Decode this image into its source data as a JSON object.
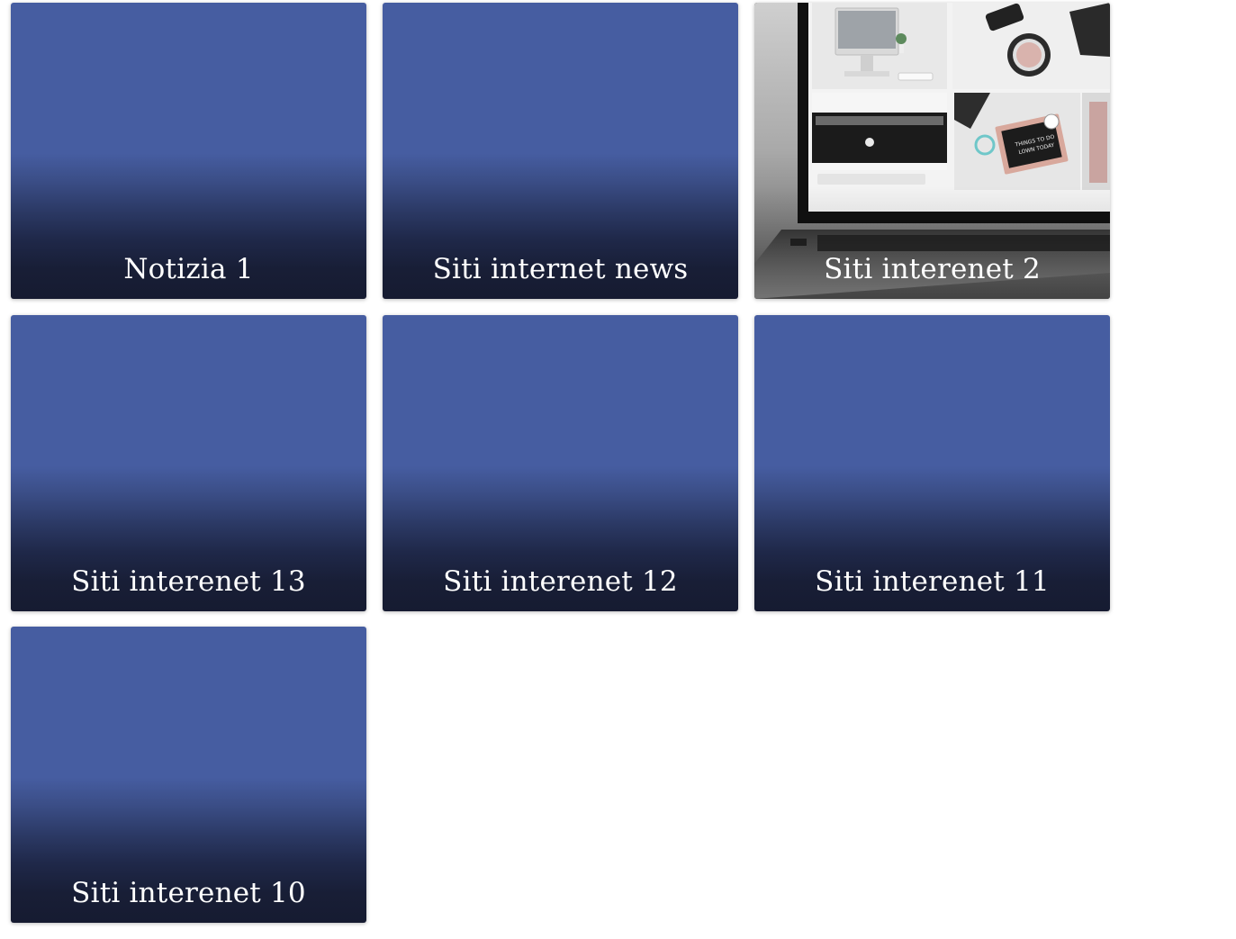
{
  "cards": [
    {
      "title": "Notizia 1",
      "image": null
    },
    {
      "title": "Siti internet news",
      "image": null
    },
    {
      "title": "Siti interenet 2",
      "image": "laptop-desk-collage-photo"
    },
    {
      "title": "Siti interenet 13",
      "image": null
    },
    {
      "title": "Siti interenet 12",
      "image": null
    },
    {
      "title": "Siti interenet 11",
      "image": null
    },
    {
      "title": "Siti interenet 10",
      "image": null
    }
  ],
  "colors": {
    "card_top": "#465da1",
    "card_bottom": "#161b31",
    "title_text": "#ffffff",
    "page_background": "#ffffff"
  },
  "photo_text": {
    "letterboard": "THINGS TO DO\nLOWN TODAY\n1.\n2.\n3."
  }
}
